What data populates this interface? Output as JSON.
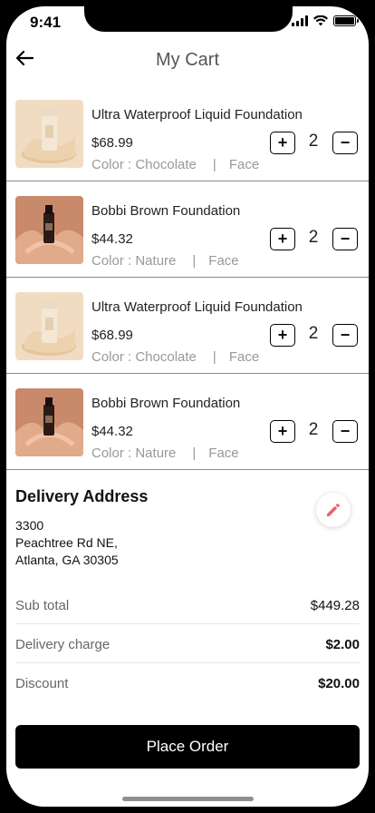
{
  "status_bar": {
    "time": "9:41"
  },
  "header": {
    "title": "My Cart"
  },
  "cart": {
    "items": [
      {
        "name": "Ultra Waterproof Liquid Foundation",
        "price": "$68.99",
        "color_text": "Color : Chocolate",
        "separator": "|",
        "category": "Face",
        "quantity": "2",
        "plus_label": "+",
        "minus_label": "−",
        "thumb": "beige-bottle"
      },
      {
        "name": "Bobbi Brown Foundation",
        "price": "$44.32",
        "color_text": "Color : Nature",
        "separator": "|",
        "category": "Face",
        "quantity": "2",
        "plus_label": "+",
        "minus_label": "−",
        "thumb": "dark-bottle"
      },
      {
        "name": "Ultra Waterproof Liquid Foundation",
        "price": "$68.99",
        "color_text": "Color : Chocolate",
        "separator": "|",
        "category": "Face",
        "quantity": "2",
        "plus_label": "+",
        "minus_label": "−",
        "thumb": "beige-bottle"
      },
      {
        "name": "Bobbi Brown Foundation",
        "price": "$44.32",
        "color_text": "Color : Nature",
        "separator": "|",
        "category": "Face",
        "quantity": "2",
        "plus_label": "+",
        "minus_label": "−",
        "thumb": "dark-bottle"
      }
    ]
  },
  "address": {
    "title": "Delivery Address",
    "lines": [
      "3300",
      "Peachtree Rd NE,",
      "Atlanta, GA 30305"
    ],
    "edit_icon": "pencil-icon",
    "edit_icon_color": "#e8626a"
  },
  "summary": {
    "rows": [
      {
        "label": "Sub total",
        "value": "$449.28"
      },
      {
        "label": "Delivery charge",
        "value": "$2.00"
      },
      {
        "label": "Discount",
        "value": "$20.00"
      }
    ]
  },
  "actions": {
    "place_order": "Place Order"
  },
  "colors": {
    "primary": "#000000",
    "muted_text": "#999999",
    "accent": "#e8626a"
  }
}
